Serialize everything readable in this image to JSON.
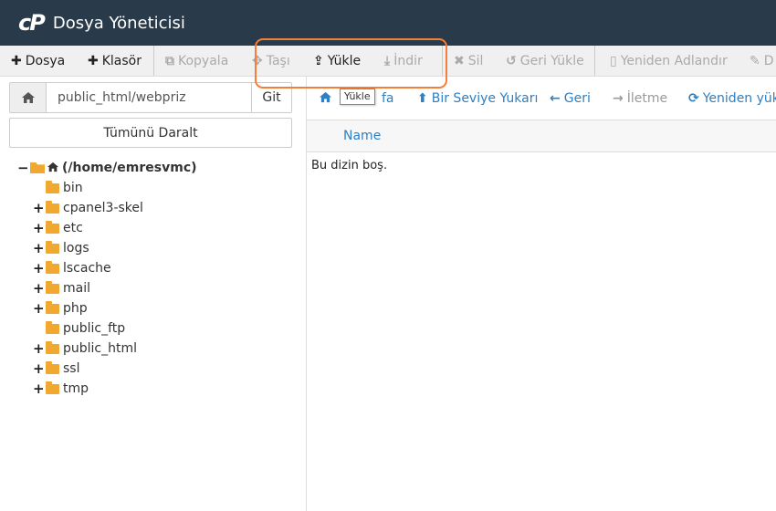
{
  "header": {
    "logo": "cP",
    "title": "Dosya Yöneticisi"
  },
  "toolbar": {
    "file": "Dosya",
    "folder": "Klasör",
    "copy": "Kopyala",
    "move": "Taşı",
    "upload": "Yükle",
    "download": "İndir",
    "delete": "Sil",
    "restore": "Geri Yükle",
    "rename": "Yeniden Adlandır",
    "edit": "D"
  },
  "tooltip": "Yükle",
  "path": {
    "value": "public_html/webpriz",
    "go": "Git"
  },
  "collapse_all": "Tümünü Daralt",
  "tree": {
    "root": "(/home/emresvmc)",
    "items": [
      {
        "label": "bin",
        "expandable": false
      },
      {
        "label": "cpanel3-skel",
        "expandable": true
      },
      {
        "label": "etc",
        "expandable": true
      },
      {
        "label": "logs",
        "expandable": true
      },
      {
        "label": "lscache",
        "expandable": true
      },
      {
        "label": "mail",
        "expandable": true
      },
      {
        "label": "php",
        "expandable": true
      },
      {
        "label": "public_ftp",
        "expandable": false
      },
      {
        "label": "public_html",
        "expandable": true
      },
      {
        "label": "ssl",
        "expandable": true
      },
      {
        "label": "tmp",
        "expandable": true
      }
    ]
  },
  "nav": {
    "home": "Ana Sayfa",
    "home_visible": "fa",
    "up": "Bir Seviye Yukarı",
    "back": "Geri",
    "forward": "İletme",
    "reload": "Yeniden yük"
  },
  "table": {
    "col_name": "Name",
    "empty": "Bu dizin boş."
  },
  "colors": {
    "header_bg": "#293a4a",
    "accent": "#2f7fc1",
    "highlight": "#f47f3a",
    "folder": "#f0a830"
  }
}
